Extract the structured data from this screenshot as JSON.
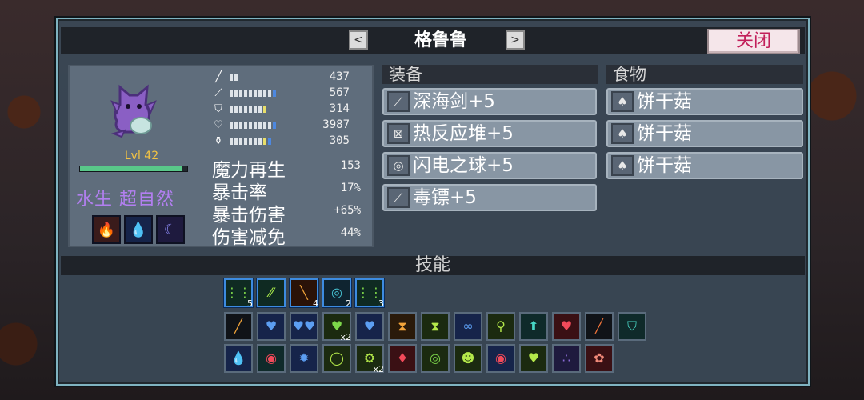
{
  "dialog": {
    "pet_name": "格鲁鲁",
    "prev_label": "<",
    "next_label": ">",
    "close_label": "关闭"
  },
  "pet": {
    "level": "Lvl 42",
    "level_progress": 0.95,
    "traits": "水生 超自然",
    "trait_icons": [
      "fire-up-icon",
      "water-shield-icon",
      "moon-icon"
    ]
  },
  "stats": [
    {
      "icon": "sword-icon",
      "value": "437"
    },
    {
      "icon": "wand-icon",
      "value": "567"
    },
    {
      "icon": "shield-icon",
      "value": "314"
    },
    {
      "icon": "heart-icon",
      "value": "3987"
    },
    {
      "icon": "potion-icon",
      "value": "305"
    }
  ],
  "attributes": [
    {
      "label": "魔力再生",
      "value": "153"
    },
    {
      "label": "暴击率",
      "value": "17%"
    },
    {
      "label": "暴击伤害",
      "value": "+65%"
    },
    {
      "label": "伤害减免",
      "value": "44%"
    }
  ],
  "equipment": {
    "header": "装备",
    "items": [
      {
        "icon": "feather-sword-icon",
        "label": "深海剑+5"
      },
      {
        "icon": "reactor-pile-icon",
        "label": "热反应堆+5"
      },
      {
        "icon": "lightning-orb-icon",
        "label": "闪电之球+5"
      },
      {
        "icon": "poison-dart-icon",
        "label": "毒镖+5"
      }
    ]
  },
  "food": {
    "header": "食物",
    "items": [
      {
        "icon": "mushroom-icon",
        "label": "饼干菇"
      },
      {
        "icon": "mushroom-icon",
        "label": "饼干菇"
      },
      {
        "icon": "mushroom-icon",
        "label": "饼干菇"
      }
    ]
  },
  "skills": {
    "header": "技能",
    "active": [
      {
        "icon": "poison-rain-icon",
        "count": "5"
      },
      {
        "icon": "acid-storm-icon",
        "count": ""
      },
      {
        "icon": "fire-slash-icon",
        "count": "4"
      },
      {
        "icon": "water-ring-icon",
        "count": "2"
      },
      {
        "icon": "rain-icon",
        "count": "3"
      }
    ],
    "passive_row1": [
      {
        "icon": "sword-glow-icon",
        "count": ""
      },
      {
        "icon": "heart-shield-icon",
        "count": ""
      },
      {
        "icon": "twin-hearts-icon",
        "count": ""
      },
      {
        "icon": "green-heart-icon",
        "count": "x2"
      },
      {
        "icon": "blue-heart-icon",
        "count": ""
      },
      {
        "icon": "hourglass-icon",
        "count": ""
      },
      {
        "icon": "green-hourglass-icon",
        "count": ""
      },
      {
        "icon": "link-icon",
        "count": ""
      },
      {
        "icon": "compass-icon",
        "count": ""
      },
      {
        "icon": "arrow-up-icon",
        "count": ""
      },
      {
        "icon": "red-heart-plus-icon",
        "count": ""
      },
      {
        "icon": "fire-sword-icon",
        "count": ""
      },
      {
        "icon": "heart-badge-icon",
        "count": ""
      }
    ],
    "passive_row2": [
      {
        "icon": "water-drop-icon",
        "count": ""
      },
      {
        "icon": "skull-ring-icon",
        "count": ""
      },
      {
        "icon": "water-burst-icon",
        "count": ""
      },
      {
        "icon": "sun-ring-icon",
        "count": ""
      },
      {
        "icon": "gear-ring-icon",
        "count": "x2"
      },
      {
        "icon": "heart-diamond-icon",
        "count": ""
      },
      {
        "icon": "green-circle-icon",
        "count": ""
      },
      {
        "icon": "demon-face-icon",
        "count": ""
      },
      {
        "icon": "red-eye-icon",
        "count": ""
      },
      {
        "icon": "heart-leaf-icon",
        "count": ""
      },
      {
        "icon": "dark-orbs-icon",
        "count": ""
      },
      {
        "icon": "fire-flower-icon",
        "count": ""
      }
    ]
  }
}
